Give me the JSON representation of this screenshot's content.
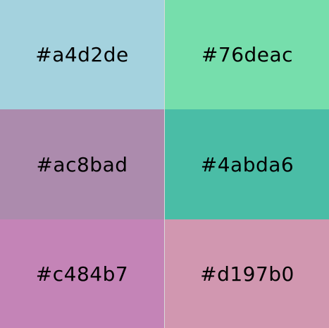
{
  "swatches": [
    {
      "label": "#a4d2de",
      "color": "#a4d2de"
    },
    {
      "label": "#76deac",
      "color": "#76deac"
    },
    {
      "label": "#ac8bad",
      "color": "#ac8bad"
    },
    {
      "label": "#4abda6",
      "color": "#4abda6"
    },
    {
      "label": "#c484b7",
      "color": "#c484b7"
    },
    {
      "label": "#d197b0",
      "color": "#d197b0"
    }
  ]
}
